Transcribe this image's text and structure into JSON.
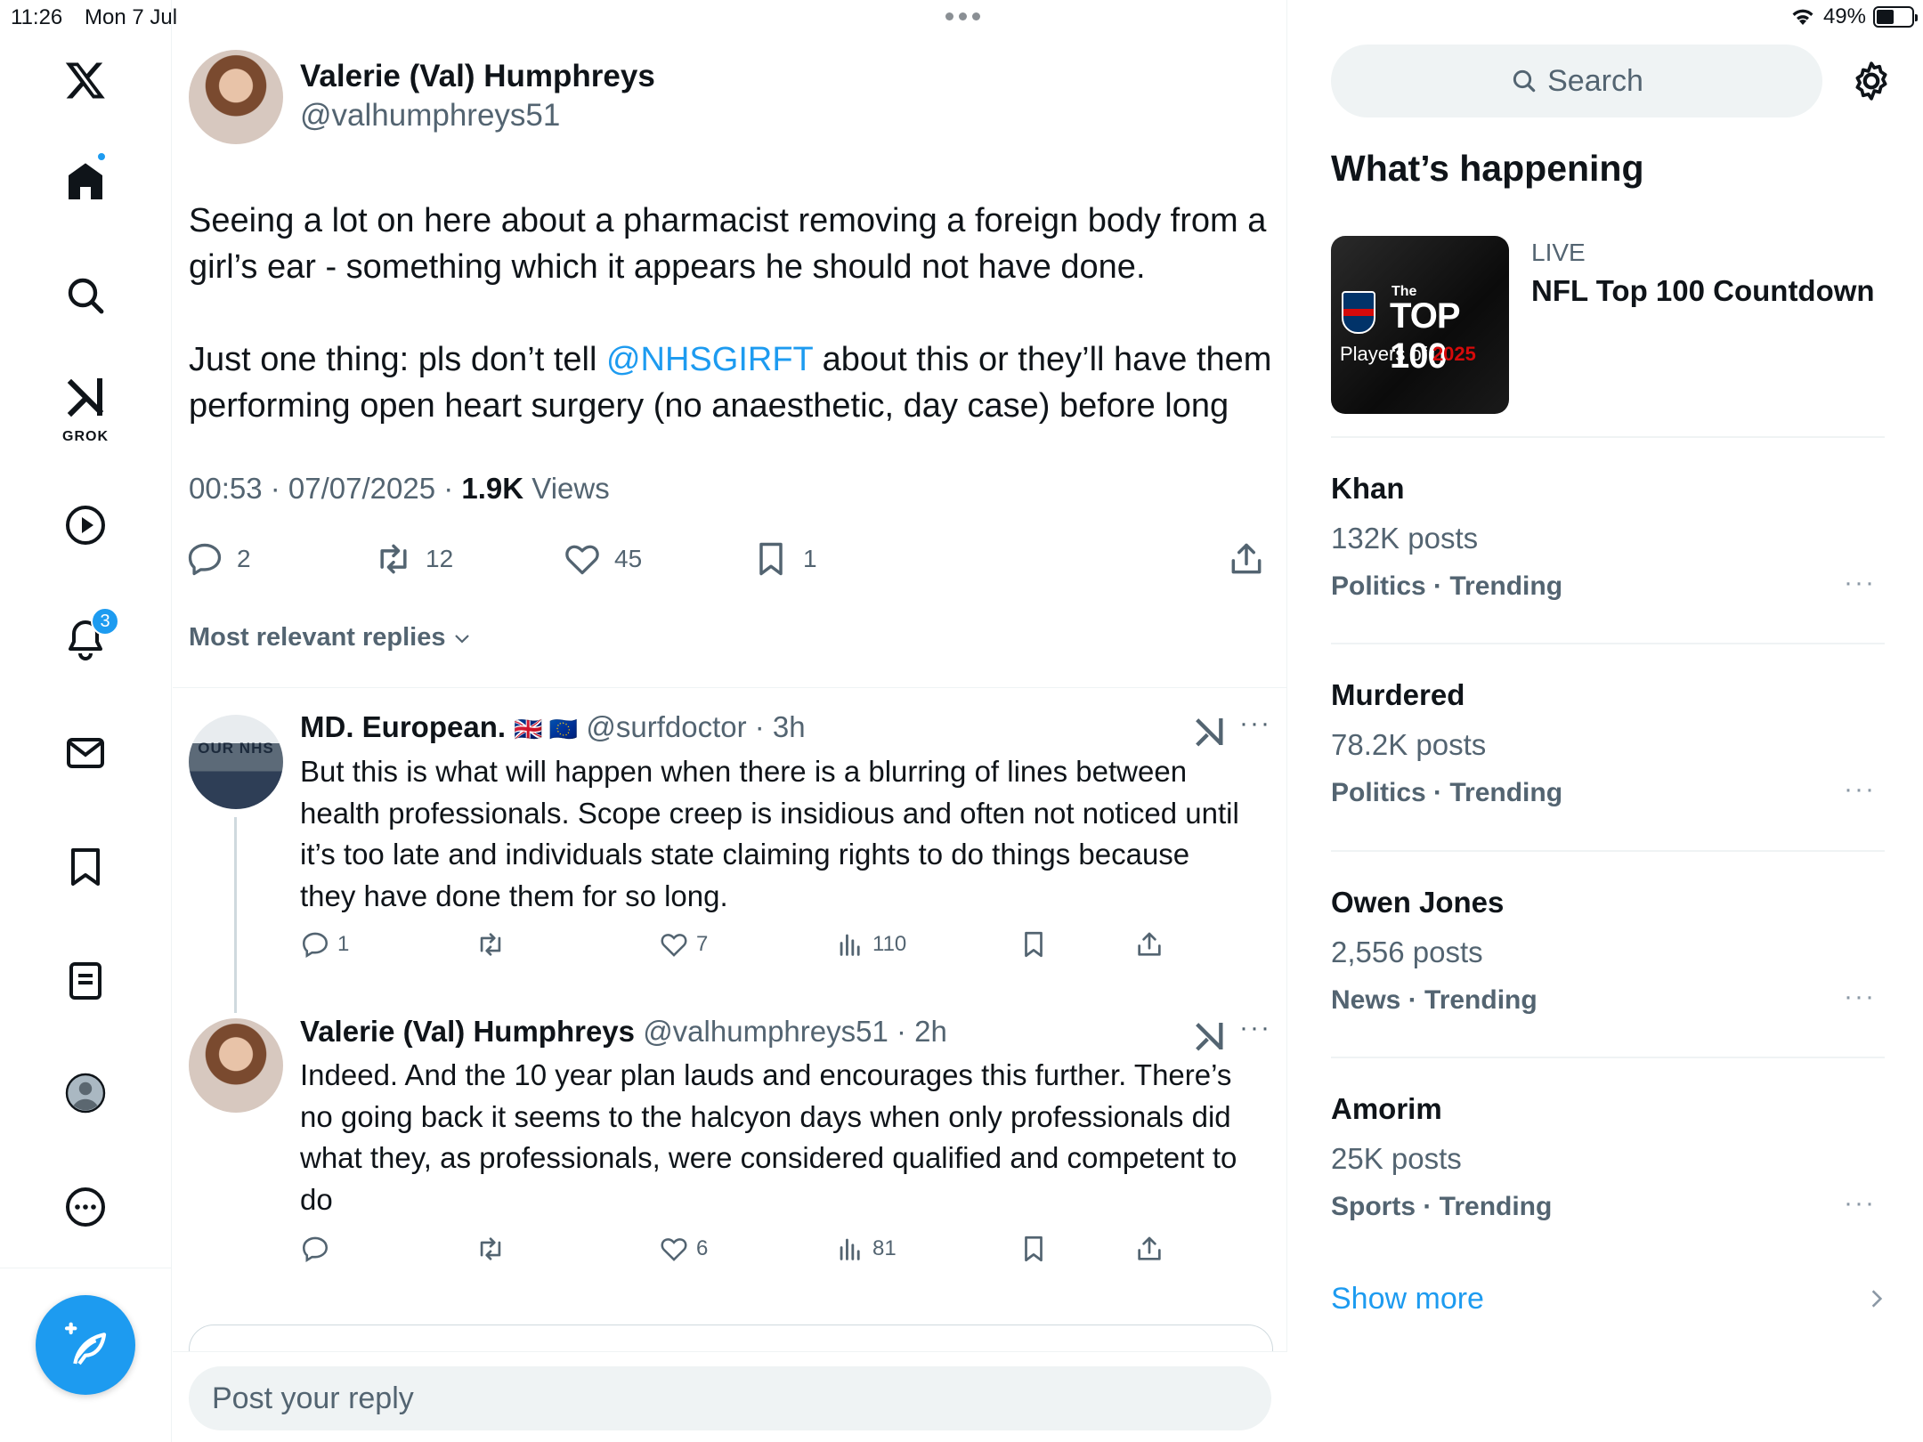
{
  "status_bar": {
    "time": "11:26",
    "date": "Mon 7 Jul",
    "battery": "49%"
  },
  "nav": {
    "grok_label": "GROK",
    "notifications_badge": "3",
    "icons": [
      "x-logo-icon",
      "home-icon",
      "search-icon",
      "grok-icon",
      "video-icon",
      "notifications-icon",
      "messages-icon",
      "bookmarks-icon",
      "lists-icon",
      "profile-icon",
      "more-icon",
      "compose-icon"
    ]
  },
  "tweet": {
    "name": "Valerie (Val) Humphreys",
    "handle": "@valhumphreys51",
    "text_p1": "Seeing a lot on here about a pharmacist removing a foreign body from a girl’s ear - something which it appears he should not have done.",
    "text_p2_before": "Just one thing: pls don’t tell ",
    "text_p2_mention": "@NHSGIRFT",
    "text_p2_after": " about this or they’ll have them performing open heart surgery (no anaesthetic, day case) before long",
    "time": "00:53 · 07/07/2025 · ",
    "views_count": "1.9K",
    "views_label": " Views",
    "replies": "2",
    "reposts": "12",
    "likes": "45",
    "bookmarks": "1"
  },
  "replies_sort": "Most relevant replies",
  "replies": [
    {
      "name": "MD. European.",
      "flags": "🇬🇧 🇪🇺",
      "handle": "@surfdoctor",
      "time": " · 3h",
      "avatar_text": "OUR NHS",
      "text": "But this is what will happen when there is a blurring of lines between health professionals. Scope creep is insidious and often not noticed until it’s too late and individuals state claiming rights to do things because they have done them for so long.",
      "replies": "1",
      "reposts": "",
      "likes": "7",
      "views": "110"
    },
    {
      "name": "Valerie (Val) Humphreys",
      "handle": "@valhumphreys51",
      "time": " · 2h",
      "text": "Indeed. And the 10 year plan lauds and encourages this further. There’s no going back it seems to the halcyon days when only professionals did what they, as professionals, were considered qualified and competent to do",
      "replies": "",
      "reposts": "",
      "likes": "6",
      "views": "81"
    }
  ],
  "reply_placeholder": "Post your reply",
  "sidebar": {
    "search_label": "Search",
    "whats_happening": "What’s happening",
    "live": {
      "label": "LIVE",
      "title": "NFL Top 100 Countdown",
      "thumb_the": "The",
      "thumb_top": "TOP 100",
      "thumb_players": "Players of ",
      "thumb_year": "2025"
    },
    "trends": [
      {
        "name": "Khan",
        "count": "132K posts",
        "category": "Politics · Trending"
      },
      {
        "name": "Murdered",
        "count": "78.2K posts",
        "category": "Politics · Trending"
      },
      {
        "name": "Owen Jones",
        "count": "2,556 posts",
        "category": "News · Trending"
      },
      {
        "name": "Amorim",
        "count": "25K posts",
        "category": "Sports · Trending"
      }
    ],
    "show_more": "Show more",
    "more_glyph": "···"
  },
  "colors": {
    "accent": "#1d9bf0",
    "text": "#0f1419",
    "muted": "#536471",
    "divider": "#eff3f4"
  }
}
